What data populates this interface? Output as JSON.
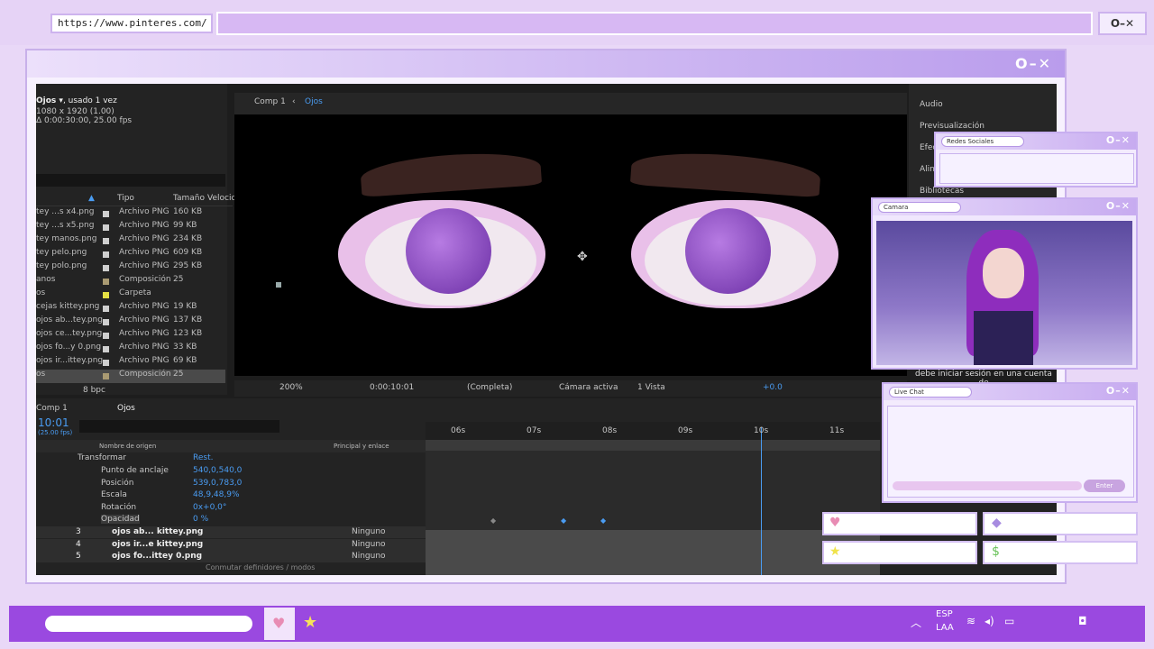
{
  "browser": {
    "url": "https://www.pinteres.com/",
    "controls": "O–✕"
  },
  "main_window": {
    "controls": "O–✕"
  },
  "project": {
    "name": "Ojos",
    "usage": ", usado 1 vez",
    "dims": "1080 x 1920 (1.00)",
    "dur": "Δ 0:00:30:00, 25.00 fps",
    "columns": [
      "Tipo",
      "Tamaño",
      "Velocid."
    ],
    "rows": [
      {
        "name": "tey ...s x4.png",
        "type": "Archivo PNG",
        "size": "160 KB",
        "color": "#cfcfcf"
      },
      {
        "name": "tey ...s x5.png",
        "type": "Archivo PNG",
        "size": "99 KB",
        "color": "#cfcfcf"
      },
      {
        "name": "tey manos.png",
        "type": "Archivo PNG",
        "size": "234 KB",
        "color": "#cfcfcf"
      },
      {
        "name": "tey pelo.png",
        "type": "Archivo PNG",
        "size": "609 KB",
        "color": "#cfcfcf"
      },
      {
        "name": "tey polo.png",
        "type": "Archivo PNG",
        "size": "295 KB",
        "color": "#cfcfcf"
      },
      {
        "name": "anos",
        "type": "Composición",
        "size": "25",
        "color": "#a99a72"
      },
      {
        "name": "os",
        "type": "Carpeta",
        "size": "",
        "color": "#e4e043"
      },
      {
        "name": "cejas kittey.png",
        "type": "Archivo PNG",
        "size": "19 KB",
        "color": "#cfcfcf"
      },
      {
        "name": "ojos ab...tey.png",
        "type": "Archivo PNG",
        "size": "137 KB",
        "color": "#cfcfcf"
      },
      {
        "name": "ojos ce...tey.png",
        "type": "Archivo PNG",
        "size": "123 KB",
        "color": "#cfcfcf"
      },
      {
        "name": "ojos fo...y 0.png",
        "type": "Archivo PNG",
        "size": "33 KB",
        "color": "#cfcfcf"
      },
      {
        "name": "ojos ir...ittey.png",
        "type": "Archivo PNG",
        "size": "69 KB",
        "color": "#cfcfcf"
      },
      {
        "name": "os",
        "type": "Composición",
        "size": "25",
        "color": "#a99a72"
      }
    ],
    "bpc": "8 bpc"
  },
  "viewer": {
    "breadcrumb1": "Comp 1",
    "breadcrumb2": "Ojos",
    "zoom": "200%",
    "time": "0:00:10:01",
    "quality": "(Completa)",
    "camera": "Cámara activa",
    "views": "1 Vista",
    "exposure": "+0.0"
  },
  "right_panel": {
    "items": [
      "Audio",
      "Previsualización",
      "Efec",
      "Alin",
      "Bibliotecas"
    ]
  },
  "timeline": {
    "tab1": "Comp 1",
    "tab2": "Ojos",
    "time": "10:01",
    "fps": "(25.00 fps)",
    "col_name": "Nombre de origen",
    "col_parent": "Principal y enlace",
    "ruler": [
      "06s",
      "07s",
      "08s",
      "09s",
      "10s",
      "11s"
    ],
    "transform": "Transformar",
    "reset": "Rest.",
    "props": [
      {
        "name": "Punto de anclaje",
        "value": "540,0,540,0"
      },
      {
        "name": "Posición",
        "value": "539,0,783,0"
      },
      {
        "name": "Escala",
        "value": "48,9,48,9%"
      },
      {
        "name": "Rotación",
        "value": "0x+0,0°"
      },
      {
        "name": "Opacidad",
        "value": "0 %"
      }
    ],
    "layers": [
      {
        "num": "3",
        "name": "ojos ab... kittey.png",
        "parent": "Ninguno"
      },
      {
        "num": "4",
        "name": "ojos ir...e kittey.png",
        "parent": "Ninguno"
      },
      {
        "num": "5",
        "name": "ojos fo...ittey 0.png",
        "parent": "Ninguno"
      }
    ],
    "footer": "Conmutar definidores / modos"
  },
  "social": {
    "title": "Redes Sociales"
  },
  "camera": {
    "title": "Camara",
    "caption": "debe iniciar sesión en una cuenta de"
  },
  "chat": {
    "title": "Live Chat",
    "enter": "Enter"
  },
  "taskbar": {
    "lang1": "ESP",
    "lang2": "LAA"
  },
  "colors": {
    "accent": "#9a49e0",
    "ae_blue": "#4a9cf2"
  }
}
